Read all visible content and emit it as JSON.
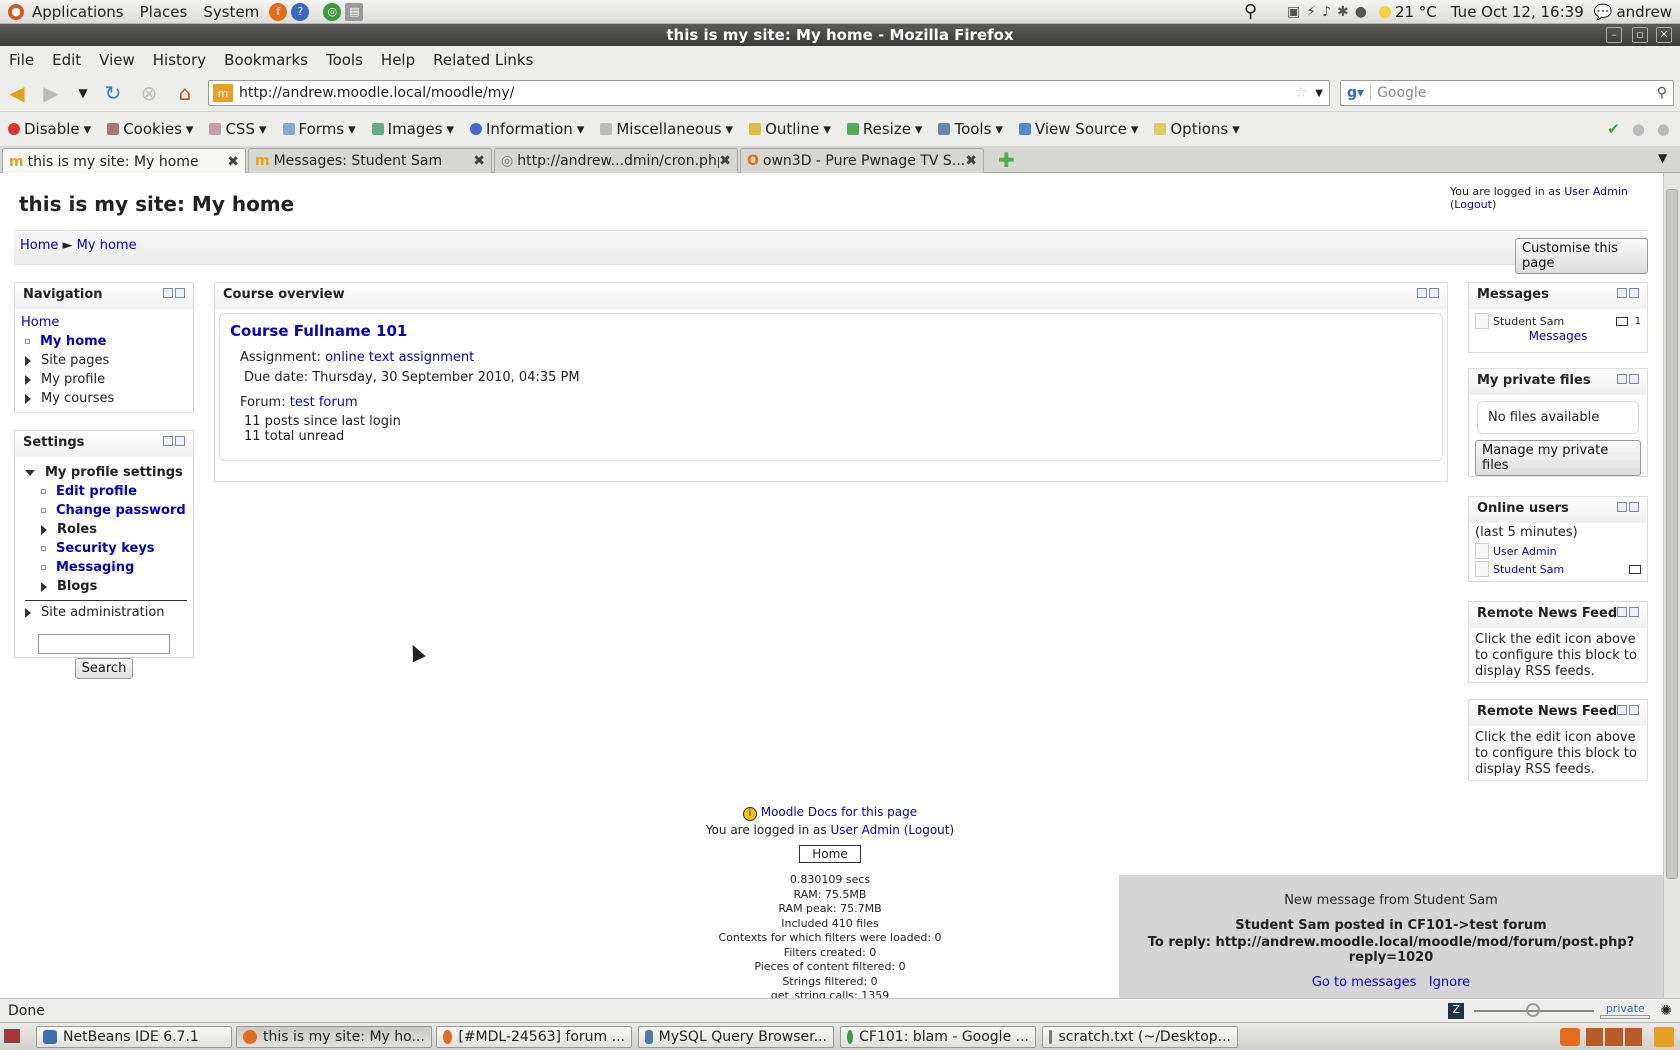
{
  "gnome": {
    "menus": [
      "Applications",
      "Places",
      "System"
    ],
    "temperature": "21 °C",
    "datetime": "Tue Oct 12, 16:39",
    "username": "andrew"
  },
  "window": {
    "title": "this is my site: My home - Mozilla Firefox"
  },
  "menubar": [
    "File",
    "Edit",
    "View",
    "History",
    "Bookmarks",
    "Tools",
    "Help",
    "Related Links"
  ],
  "navbar": {
    "url": "http://andrew.moodle.local/moodle/my/",
    "search_placeholder": "Google"
  },
  "webdev_toolbar": [
    "Disable",
    "Cookies",
    "CSS",
    "Forms",
    "Images",
    "Information",
    "Miscellaneous",
    "Outline",
    "Resize",
    "Tools",
    "View Source",
    "Options"
  ],
  "tabs": [
    {
      "label": "this is my site: My home",
      "active": true
    },
    {
      "label": "Messages: Student Sam",
      "active": false
    },
    {
      "label": "http://andrew...dmin/cron.php",
      "active": false
    },
    {
      "label": "own3D - Pure Pwnage TV S...",
      "active": false
    }
  ],
  "page": {
    "site_title": "this is my site: My home",
    "login_info_prefix": "You are logged in as",
    "login_user": "User Admin",
    "logout": "Logout",
    "breadcrumb": {
      "home": "Home",
      "sep": "►",
      "current": "My home"
    },
    "customise_button": "Customise this page"
  },
  "navigation": {
    "title": "Navigation",
    "home": "Home",
    "items": [
      "My home",
      "Site pages",
      "My profile",
      "My courses"
    ]
  },
  "settings": {
    "title": "Settings",
    "profile_settings": "My profile settings",
    "items": [
      "Edit profile",
      "Change password",
      "Roles",
      "Security keys",
      "Messaging",
      "Blogs"
    ],
    "site_admin": "Site administration",
    "search_button": "Search"
  },
  "course_overview": {
    "title": "Course overview",
    "course_name": "Course Fullname 101",
    "assignment_label": "Assignment:",
    "assignment_link": "online text assignment",
    "due_date": "Due date: Thursday, 30 September 2010, 04:35 PM",
    "forum_label": "Forum:",
    "forum_link": "test forum",
    "posts_since": "11 posts since last login",
    "total_unread": "11 total unread"
  },
  "messages_block": {
    "title": "Messages",
    "sender": "Student Sam",
    "count": "1",
    "link": "Messages"
  },
  "private_files": {
    "title": "My private files",
    "empty": "No files available",
    "button": "Manage my private files"
  },
  "online_users": {
    "title": "Online users",
    "period": "(last 5 minutes)",
    "users": [
      "User Admin",
      "Student Sam"
    ]
  },
  "rss_blocks": [
    {
      "title": "Remote News Feed",
      "text": "Click the edit icon above to configure this block to display RSS feeds."
    },
    {
      "title": "Remote News Feed",
      "text": "Click the edit icon above to configure this block to display RSS feeds."
    }
  ],
  "footer": {
    "docs_link": "Moodle Docs for this page",
    "login_prefix": "You are logged in as",
    "login_user": "User Admin",
    "logout": "Logout",
    "home_button": "Home",
    "perf": [
      "0.830109 secs",
      "RAM: 75.5MB",
      "RAM peak: 75.7MB",
      "Included 410 files",
      "Contexts for which filters were loaded: 0",
      "Filters created: 0",
      "Pieces of content filtered: 0",
      "Strings filtered: 0",
      "get_string calls: 1359"
    ]
  },
  "popup": {
    "heading": "New message from Student Sam",
    "line1": "Student Sam posted in CF101->test forum",
    "line2": "To reply: http://andrew.moodle.local/moodle/mod/forum/post.php?reply=1020",
    "go": "Go to messages",
    "ignore": "Ignore"
  },
  "statusbar": {
    "status": "Done",
    "private": "private"
  },
  "taskbar": [
    {
      "label": "NetBeans IDE 6.7.1",
      "color": "#3a6fb0"
    },
    {
      "label": "this is my site: My ho...",
      "color": "#e36b1c",
      "active": true
    },
    {
      "label": "[#MDL-24563] forum ...",
      "color": "#e36b1c"
    },
    {
      "label": "MySQL Query Browser...",
      "color": "#4a7aa8"
    },
    {
      "label": "CF101: blam - Google ...",
      "color": "#3b9a3b"
    },
    {
      "label": "scratch.txt (~/Desktop...",
      "color": "#777777"
    }
  ]
}
